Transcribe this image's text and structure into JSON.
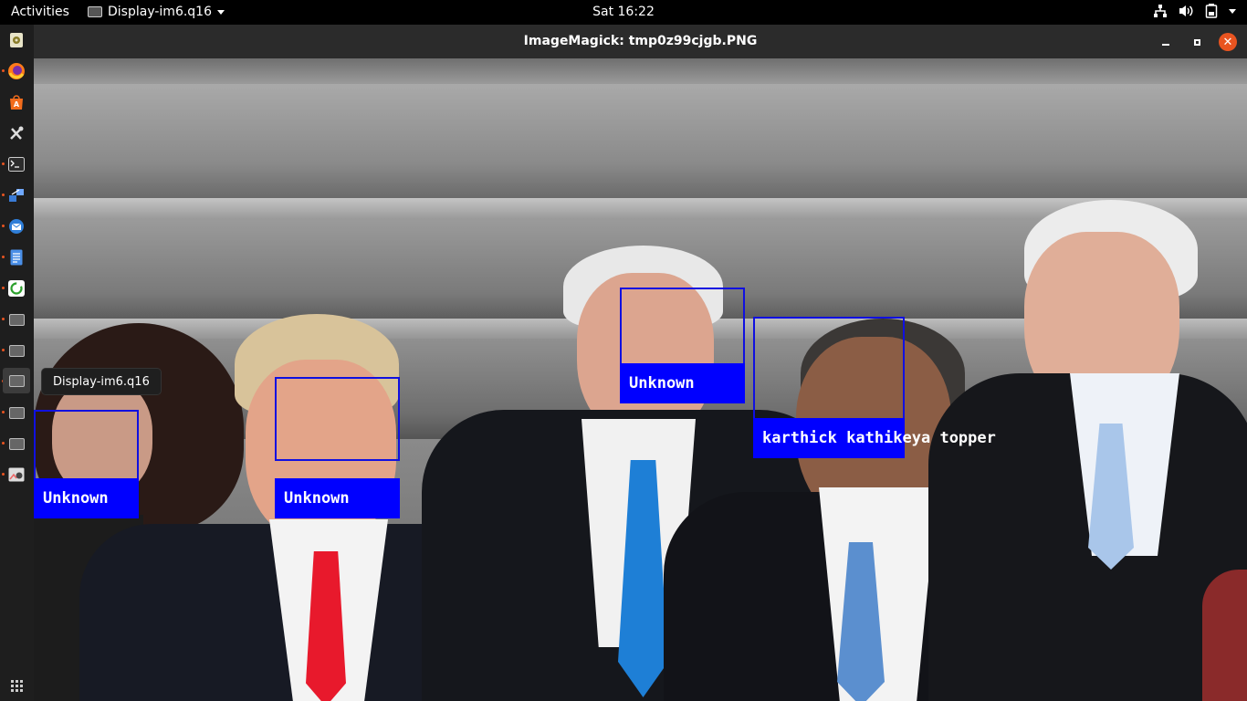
{
  "topbar": {
    "activities": "Activities",
    "app_menu_label": "Display-im6.q16",
    "clock": "Sat 16:22",
    "tray_icons": [
      "network-icon",
      "volume-icon",
      "battery-icon",
      "system-menu-caret-icon"
    ]
  },
  "dock": {
    "items": [
      {
        "name": "dock-rhythmbox-icon"
      },
      {
        "name": "dock-firefox-icon"
      },
      {
        "name": "dock-software-center-icon"
      },
      {
        "name": "dock-tools-icon"
      },
      {
        "name": "dock-terminal-icon"
      },
      {
        "name": "dock-transfer-icon"
      },
      {
        "name": "dock-thunderbird-icon"
      },
      {
        "name": "dock-document-icon"
      },
      {
        "name": "dock-refresh-icon"
      },
      {
        "name": "dock-window-icon"
      },
      {
        "name": "dock-window-icon"
      },
      {
        "name": "dock-window-icon"
      },
      {
        "name": "dock-window-icon"
      },
      {
        "name": "dock-window-icon"
      },
      {
        "name": "dock-image-viewer-icon"
      }
    ],
    "tooltip": "Display-im6.q16"
  },
  "window": {
    "title": "ImageMagick: tmp0z99cjgb.PNG",
    "close_glyph": "✕"
  },
  "detections": [
    {
      "label": "Unknown"
    },
    {
      "label": "Unknown"
    },
    {
      "label": "Unknown"
    },
    {
      "label": "karthick kathikeya topper"
    }
  ],
  "colors": {
    "box_border": "#1010e0",
    "label_bg": "#0000ff",
    "accent": "#e95420"
  }
}
